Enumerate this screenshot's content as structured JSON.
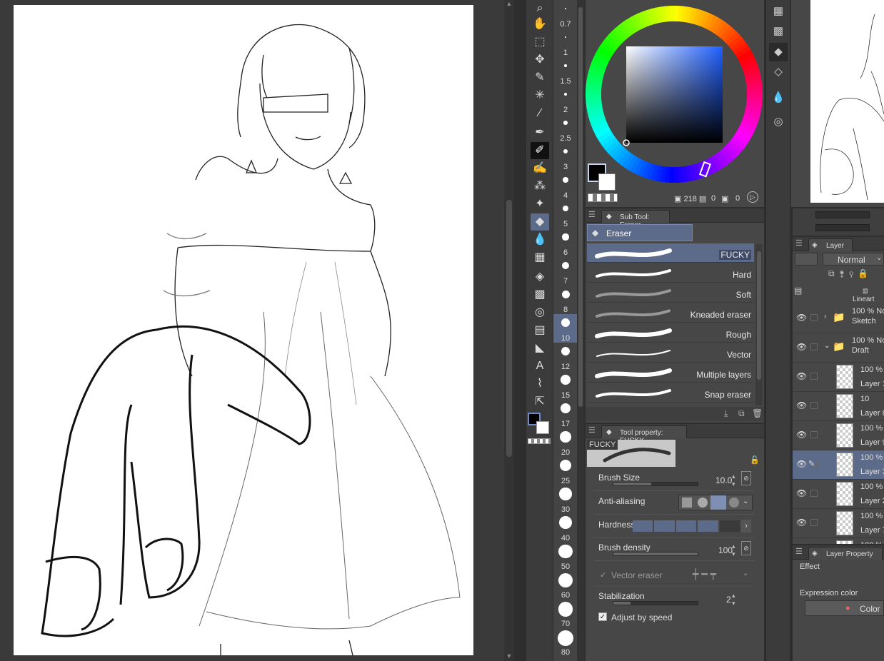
{
  "ruler_labels": [
    "0.7",
    "1",
    "1.5",
    "2",
    "2.5",
    "3",
    "4",
    "5",
    "6",
    "7",
    "8",
    "10",
    "12",
    "15",
    "17",
    "20",
    "25",
    "30",
    "40",
    "50",
    "60",
    "70",
    "80"
  ],
  "color": {
    "hue_value": "218",
    "sat_value": "0",
    "val_value": "0",
    "foreground": "#000000",
    "background": "#ffffff"
  },
  "subtool": {
    "tab_label": "Sub Tool: Eraser",
    "group_label": "Eraser",
    "brushes": [
      "FUCKY",
      "Hard",
      "Soft",
      "Kneaded eraser",
      "Rough",
      "Vector",
      "Multiple layers",
      "Snap eraser"
    ],
    "selected": "FUCKY"
  },
  "toolprop": {
    "tab_label": "Tool property: FUCKY",
    "preview_label": "FUCKY",
    "brush_size_label": "Brush Size",
    "brush_size_value": "10.0",
    "brush_size_fraction": 0.45,
    "anti_aliasing_label": "Anti-aliasing",
    "hardness_label": "Hardness",
    "brush_density_label": "Brush density",
    "brush_density_value": "100",
    "brush_density_fraction": 1.0,
    "vector_eraser_label": "Vector eraser",
    "stabilization_label": "Stabilization",
    "stabilization_value": "2",
    "stabilization_fraction": 0.2,
    "adjust_by_speed_label": "Adjust by speed"
  },
  "layer": {
    "tab_label": "Layer",
    "blend_mode": "Normal",
    "rows": [
      {
        "opacity": "100 % No",
        "name": "Sketch",
        "type": "folder"
      },
      {
        "opacity": "100 % No",
        "name": "Draft",
        "type": "folder"
      },
      {
        "opacity": "100 % N",
        "name": "Layer 1",
        "type": "layer"
      },
      {
        "opacity": "10",
        "name": "Layer 8",
        "type": "layer"
      },
      {
        "opacity": "100 % N",
        "name": "Layer 9",
        "type": "layer"
      },
      {
        "opacity": "100 % N",
        "name": "Layer 3",
        "type": "layer",
        "active": true
      },
      {
        "opacity": "100 % N",
        "name": "Layer 2",
        "type": "layer"
      },
      {
        "opacity": "100 % N",
        "name": "Layer 7",
        "type": "layer"
      },
      {
        "opacity": "100 % N",
        "name": "",
        "type": "layer"
      }
    ],
    "partial_top_label": "Lineart"
  },
  "layer_property": {
    "tab_label": "Layer Property",
    "effect_label": "Effect",
    "expression_color_label": "Expression color",
    "color_button_label": "Color"
  }
}
